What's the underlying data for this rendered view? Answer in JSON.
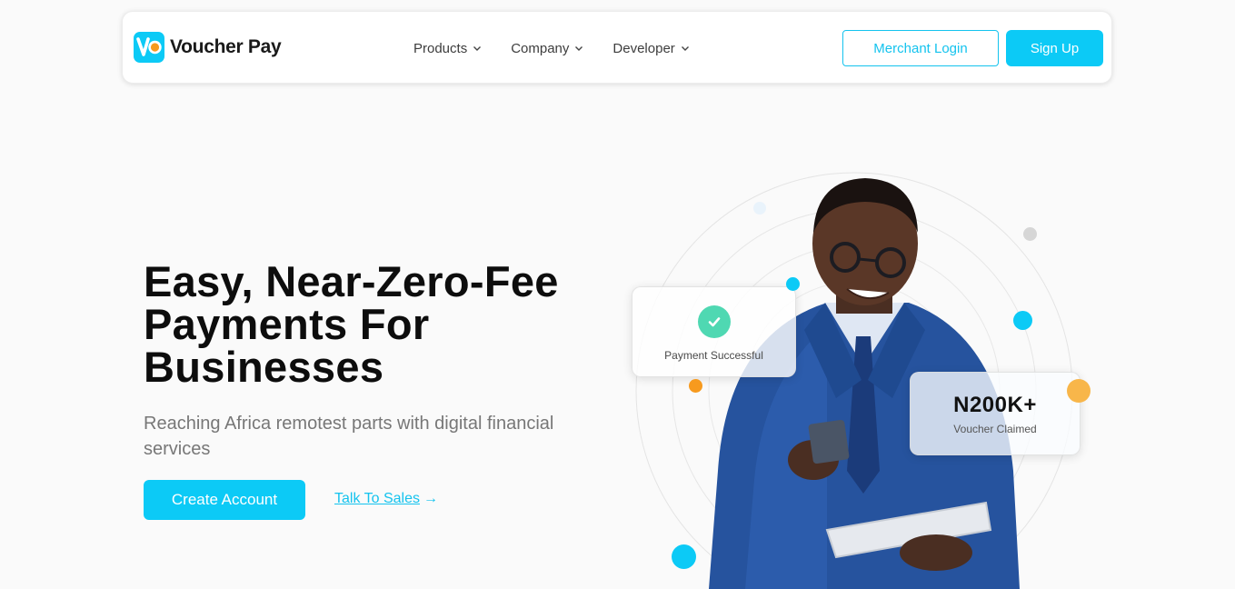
{
  "brand": {
    "name": "Voucher Pay",
    "colors": {
      "accent": "#0ccaf6",
      "logo_orange": "#f79a1e",
      "text_dark": "#0d0d0d"
    }
  },
  "nav": {
    "items": [
      {
        "label": "Products",
        "icon": "chevron-down-icon"
      },
      {
        "label": "Company",
        "icon": "chevron-down-icon"
      },
      {
        "label": "Developer",
        "icon": "chevron-down-icon"
      }
    ],
    "merchant_login": "Merchant Login",
    "sign_up": "Sign Up"
  },
  "hero": {
    "title_line1": "Easy, Near-Zero-Fee",
    "title_line2": "Payments For",
    "title_line3": "Businesses",
    "subtitle": "Reaching Africa remotest parts with digital financial services",
    "create_account": "Create Account",
    "talk_to_sales": "Talk To Sales",
    "talk_to_sales_arrow": "→"
  },
  "cards": {
    "payment": {
      "label": "Payment Successful",
      "icon": "check-icon",
      "color": "#4fd8b2"
    },
    "voucher": {
      "amount": "N200K+",
      "label": "Voucher Claimed"
    }
  }
}
